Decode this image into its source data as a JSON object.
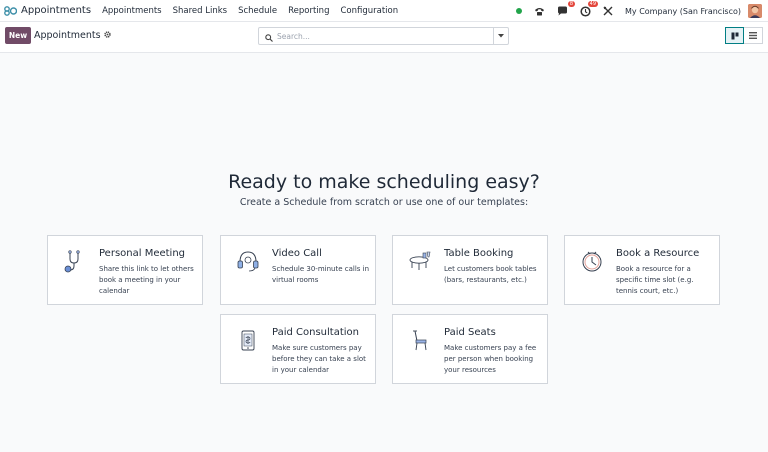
{
  "app": {
    "name": "Appointments"
  },
  "menu": [
    "Appointments",
    "Shared Links",
    "Schedule",
    "Reporting",
    "Configuration"
  ],
  "nav_right": {
    "messages_badge": "8",
    "activities_badge": "49",
    "company": "My Company (San Francisco)"
  },
  "control": {
    "new_label": "New",
    "breadcrumb": "Appointments",
    "search_placeholder": "Search..."
  },
  "hero": {
    "title": "Ready to make scheduling easy?",
    "subtitle": "Create a Schedule from scratch or use one of our templates:"
  },
  "templates": [
    {
      "title": "Personal Meeting",
      "desc": "Share this link to let others book a meeting in your calendar",
      "icon": "stethoscope-icon"
    },
    {
      "title": "Video Call",
      "desc": "Schedule 30-minute calls in virtual rooms",
      "icon": "headset-icon"
    },
    {
      "title": "Table Booking",
      "desc": "Let customers book tables (bars, restaurants, etc.)",
      "icon": "table-icon"
    },
    {
      "title": "Book a Resource",
      "desc": "Book a resource for a specific time slot (e.g. tennis court, etc.)",
      "icon": "clock-icon"
    },
    {
      "title": "Paid Consultation",
      "desc": "Make sure customers pay before they can take a slot in your calendar",
      "icon": "phone-icon"
    },
    {
      "title": "Paid Seats",
      "desc": "Make customers pay a fee per person when booking your resources",
      "icon": "chair-icon"
    }
  ],
  "colors": {
    "primary": "#714b67",
    "accent": "#017e84",
    "status": "#22a44b",
    "badge": "#e3463b"
  }
}
